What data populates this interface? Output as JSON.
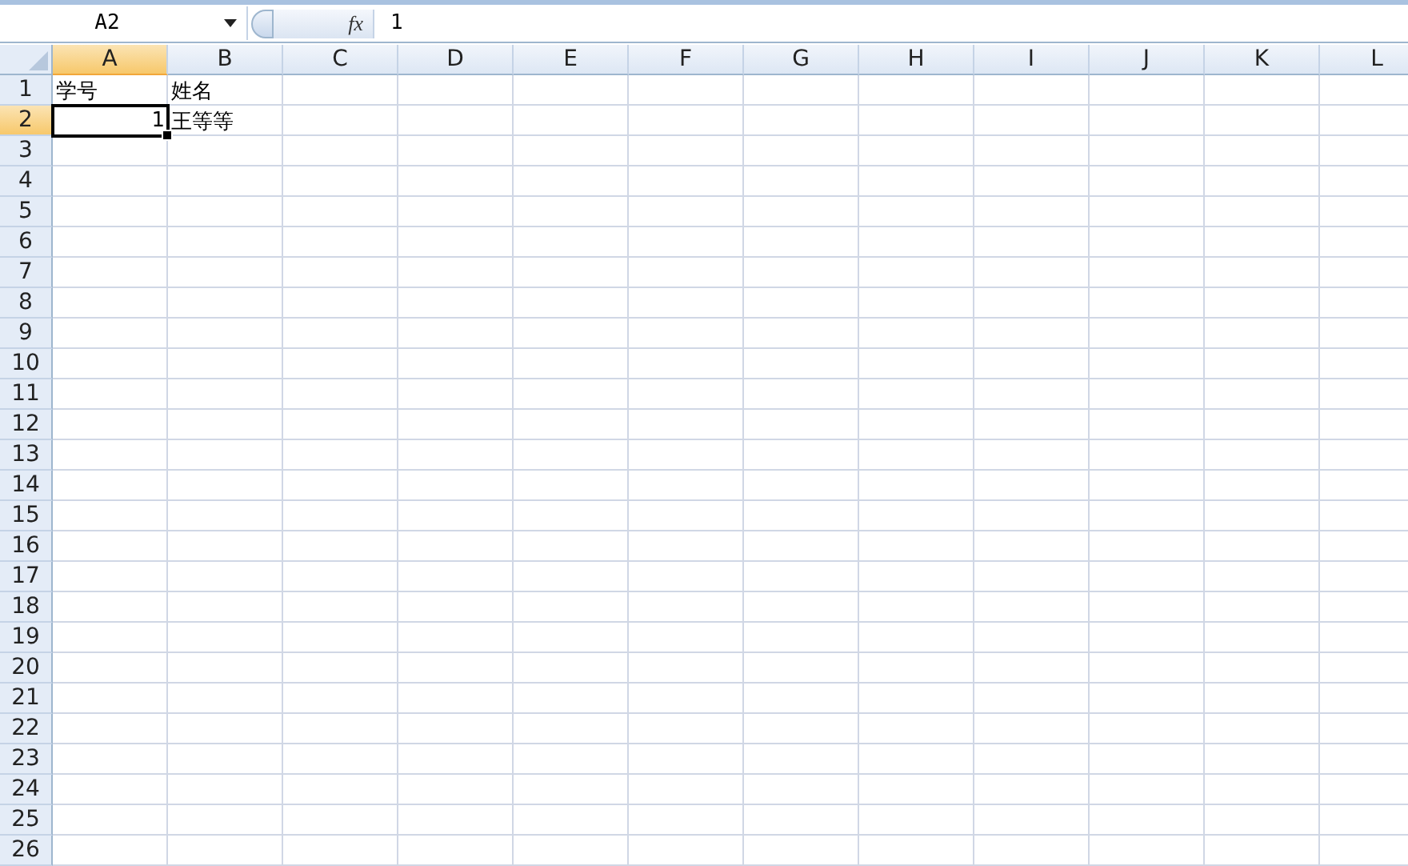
{
  "formula_bar": {
    "name_box": "A2",
    "function_button": "fx",
    "formula": "1"
  },
  "columns": [
    {
      "label": "A",
      "selected": true
    },
    {
      "label": "B",
      "selected": false
    },
    {
      "label": "C",
      "selected": false
    },
    {
      "label": "D",
      "selected": false
    },
    {
      "label": "E",
      "selected": false
    },
    {
      "label": "F",
      "selected": false
    },
    {
      "label": "G",
      "selected": false
    },
    {
      "label": "H",
      "selected": false
    },
    {
      "label": "I",
      "selected": false
    },
    {
      "label": "J",
      "selected": false
    },
    {
      "label": "K",
      "selected": false
    },
    {
      "label": "L",
      "selected": false
    }
  ],
  "rows": [
    {
      "label": "1",
      "selected": false,
      "cells": [
        {
          "text": "学号",
          "kind": "text",
          "selected": false
        },
        {
          "text": "姓名",
          "kind": "text",
          "selected": false
        }
      ]
    },
    {
      "label": "2",
      "selected": true,
      "cells": [
        {
          "text": "1",
          "kind": "number",
          "selected": true
        },
        {
          "text": "王等等",
          "kind": "text",
          "selected": false
        }
      ]
    },
    {
      "label": "3",
      "selected": false
    },
    {
      "label": "4",
      "selected": false
    },
    {
      "label": "5",
      "selected": false
    },
    {
      "label": "6",
      "selected": false
    },
    {
      "label": "7",
      "selected": false
    },
    {
      "label": "8",
      "selected": false
    },
    {
      "label": "9",
      "selected": false
    },
    {
      "label": "10",
      "selected": false
    },
    {
      "label": "11",
      "selected": false
    },
    {
      "label": "12",
      "selected": false
    },
    {
      "label": "13",
      "selected": false
    },
    {
      "label": "14",
      "selected": false
    },
    {
      "label": "15",
      "selected": false
    },
    {
      "label": "16",
      "selected": false
    },
    {
      "label": "17",
      "selected": false
    },
    {
      "label": "18",
      "selected": false
    },
    {
      "label": "19",
      "selected": false
    },
    {
      "label": "20",
      "selected": false
    },
    {
      "label": "21",
      "selected": false
    },
    {
      "label": "22",
      "selected": false
    },
    {
      "label": "23",
      "selected": false
    },
    {
      "label": "24",
      "selected": false
    },
    {
      "label": "25",
      "selected": false
    },
    {
      "label": "26",
      "selected": false
    }
  ]
}
